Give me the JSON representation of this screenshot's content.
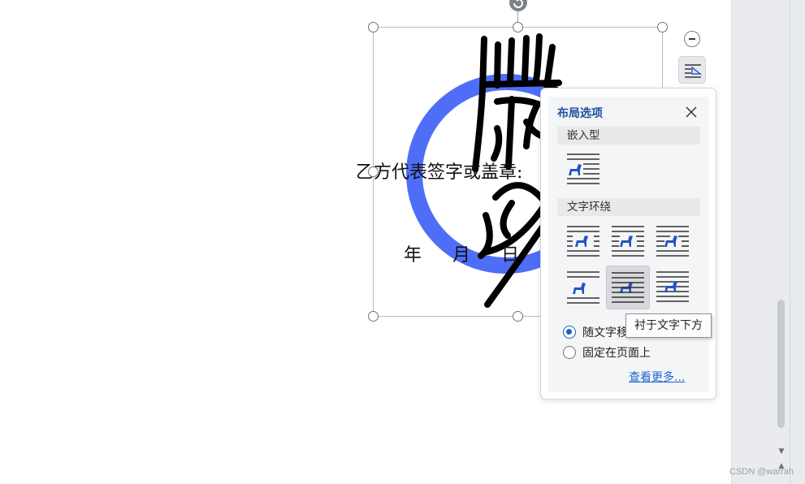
{
  "document": {
    "signature_line": "乙方代表签字或盖章:",
    "date_year": "年",
    "date_month": "月",
    "date_day": "日"
  },
  "layout_panel": {
    "title": "布局选项",
    "section_inline": "嵌入型",
    "section_wrap": "文字环绕",
    "options_inline": [
      "inline"
    ],
    "options_wrap": [
      "square",
      "tight",
      "through",
      "top-bottom",
      "behind-text",
      "in-front-of-text"
    ],
    "selected_option": "behind-text",
    "radio_move_with_text": "随文字移动",
    "radio_fixed_on_page": "固定在页面上",
    "radio_selected": "move_with_text",
    "see_more_link": "查看更多..."
  },
  "tooltip": {
    "text": "衬于文字下方"
  },
  "watermark": "CSDN @warrah",
  "colors": {
    "accent": "#1d4e9e",
    "seal_ring": "#4f6ef7",
    "link": "#1a66d0",
    "radio_on": "#1c5ec4"
  },
  "icons": {
    "close": "close-icon",
    "minus": "minus-icon",
    "layout_options": "layout-options-icon",
    "rotate": "rotate-icon",
    "horse": "horse-icon"
  }
}
